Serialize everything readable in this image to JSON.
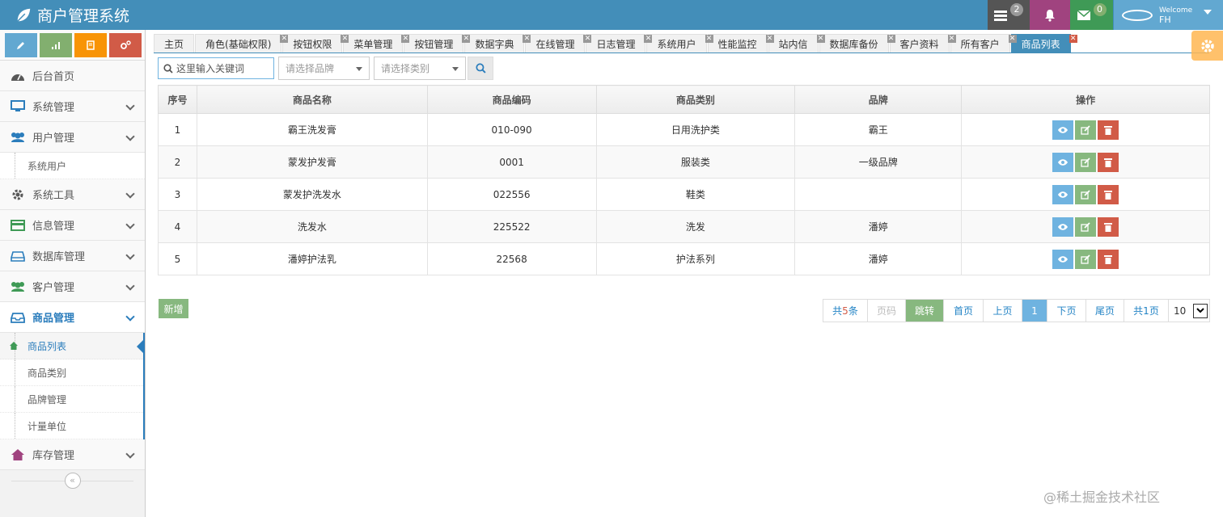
{
  "app": {
    "title": "商户管理系统"
  },
  "navbar": {
    "tasks_count": "2",
    "notifications_count": "",
    "messages_count": "0",
    "user_welcome": "Welcome",
    "user_name": "FH"
  },
  "sidebar": {
    "shortcuts": [
      "pencil-icon",
      "signal-icon",
      "book-icon",
      "cogs-icon"
    ],
    "items": [
      {
        "label": "后台首页",
        "icon": "dashboard-icon"
      },
      {
        "label": "系统管理",
        "icon": "desktop-icon"
      },
      {
        "label": "用户管理",
        "icon": "users-icon"
      },
      {
        "label": "系统工具",
        "icon": "gear-icon"
      },
      {
        "label": "信息管理",
        "icon": "credit-card-icon"
      },
      {
        "label": "数据库管理",
        "icon": "hdd-icon"
      },
      {
        "label": "客户管理",
        "icon": "users-icon"
      },
      {
        "label": "商品管理",
        "icon": "inbox-icon"
      },
      {
        "label": "库存管理",
        "icon": "home-icon"
      }
    ],
    "user_sub": [
      "系统用户"
    ],
    "goods_sub": [
      "商品列表",
      "商品类别",
      "品牌管理",
      "计量单位"
    ]
  },
  "tabs": [
    "主页",
    "角色(基础权限)",
    "按钮权限",
    "菜单管理",
    "按钮管理",
    "数据字典",
    "在线管理",
    "日志管理",
    "系统用户",
    "性能监控",
    "站内信",
    "数据库备份",
    "客户资料",
    "所有客户",
    "商品列表"
  ],
  "search": {
    "placeholder": "这里输入关键词",
    "brand_placeholder": "请选择品牌",
    "category_placeholder": "请选择类别"
  },
  "table": {
    "headers": [
      "序号",
      "商品名称",
      "商品编码",
      "商品类别",
      "品牌",
      "操作"
    ],
    "rows": [
      [
        "1",
        "霸王洗发膏",
        "010-090",
        "日用洗护类",
        "霸王"
      ],
      [
        "2",
        "蒙发护发膏",
        "0001",
        "服装类",
        "一级品牌"
      ],
      [
        "3",
        "蒙发护洗发水",
        "022556",
        "鞋类",
        ""
      ],
      [
        "4",
        "洗发水",
        "225522",
        "洗发",
        "潘婷"
      ],
      [
        "5",
        "潘婷护法乳",
        "22568",
        "护法系列",
        "潘婷"
      ]
    ]
  },
  "footer": {
    "add_label": "新增",
    "total_prefix": "共",
    "total_count": "5",
    "total_suffix": "条",
    "page_input_placeholder": "页码",
    "go_label": "跳转",
    "first_label": "首页",
    "prev_label": "上页",
    "current_page": "1",
    "next_label": "下页",
    "last_label": "尾页",
    "pages_prefix": "共",
    "pages_count": "1",
    "pages_suffix": "页",
    "page_size": "10"
  },
  "watermark": {
    "text": "@稀土掘金技术社区"
  },
  "colors": {
    "navbar": "#438eb9",
    "accent_blue": "#2b7dbc",
    "success": "#87b87f",
    "danger": "#d15b47",
    "info": "#6fb3e0",
    "warning": "#ffb752"
  }
}
